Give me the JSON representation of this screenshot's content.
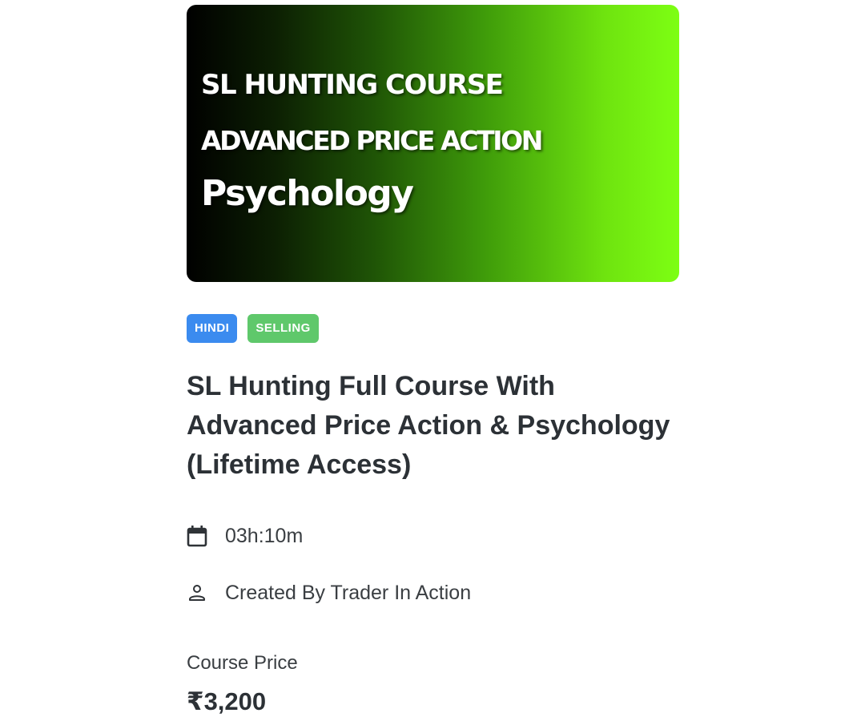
{
  "banner": {
    "line1": "SL HUNTING COURSE",
    "line2": "ADVANCED PRICE ACTION",
    "line3": "Psychology",
    "gradient_start": "#000000",
    "gradient_end": "#7dff13"
  },
  "tags": [
    {
      "label": "HINDI",
      "color": "#3b8bef"
    },
    {
      "label": "SELLING",
      "color": "#5fc86b"
    }
  ],
  "course": {
    "title": "SL Hunting Full Course With Advanced Price Action & Psychology (Lifetime Access)",
    "duration": "03h:10m",
    "duration_icon": "calendar-icon",
    "creator": "Created By Trader In Action",
    "creator_icon": "user-icon",
    "price_label": "Course Price",
    "price": "₹3,200"
  }
}
